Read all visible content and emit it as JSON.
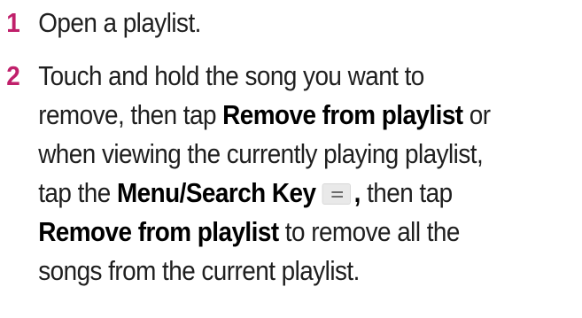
{
  "accent_color": "#c0206b",
  "steps": [
    {
      "number": "1",
      "text": "Open a playlist."
    },
    {
      "number": "2",
      "line1": "Touch and hold the song you want to",
      "line2_a": "remove, then tap ",
      "line2_bold": "Remove from playlist",
      "line2_b": " or",
      "line3": "when viewing the currently playing playlist,",
      "line4_a": "tap the ",
      "line4_bold": "Menu/Search Key",
      "line4_icon": "menu-icon",
      "line4_comma": ",",
      "line4_b": " then tap",
      "line5_bold": "Remove from playlist",
      "line5_a": " to remove all the",
      "line6": "songs from the current playlist."
    }
  ]
}
